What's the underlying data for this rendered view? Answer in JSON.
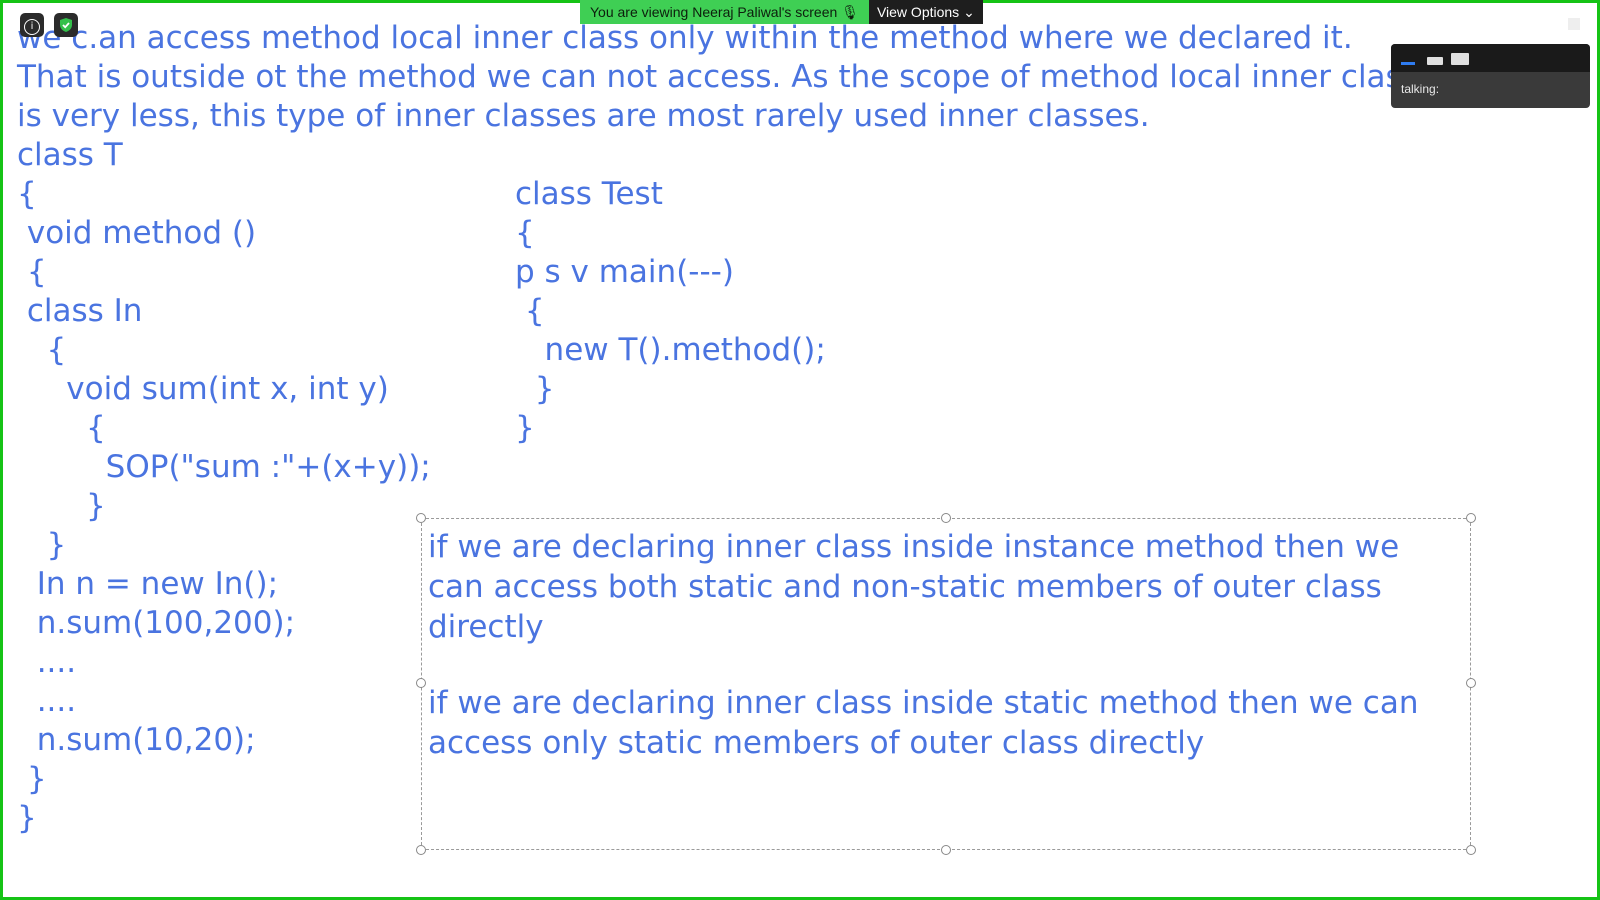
{
  "banner": {
    "message": "You are viewing Neeraj Paliwal's screen 🎙",
    "view_options": "View Options ⌄"
  },
  "mini_panel": {
    "talking": "talking:"
  },
  "slide": {
    "intro": [
      "we c.an access method local inner class only within the method where we declared it.",
      "That is outside ot the method we can not access. As the scope of method local inner classes",
      "is very less, this type of inner classes are most rarely used inner classes."
    ],
    "code_left": [
      "class T",
      "{",
      " void method ()",
      " {",
      " class In",
      "   {",
      "     void sum(int x, int y)",
      "       {",
      "         SOP(\"sum :\"+(x+y));",
      "       }",
      "   }",
      "  In n = new In();",
      "  n.sum(100,200);",
      "  ....",
      "  ....",
      "  n.sum(10,20);",
      " }",
      "}"
    ],
    "code_right": [
      "class Test",
      "{",
      "p s v main(---)",
      " {",
      "   new T().method();",
      "  }",
      "}"
    ],
    "note": {
      "para1": "if we are declaring inner class inside instance method then we can access both static and non-static members of outer class directly",
      "para2": "if we are declaring inner class inside static method then we can access only static members of outer class directly"
    }
  },
  "colors": {
    "text": "#4a74e0",
    "frame": "#16c316",
    "banner": "#3fcf54"
  }
}
